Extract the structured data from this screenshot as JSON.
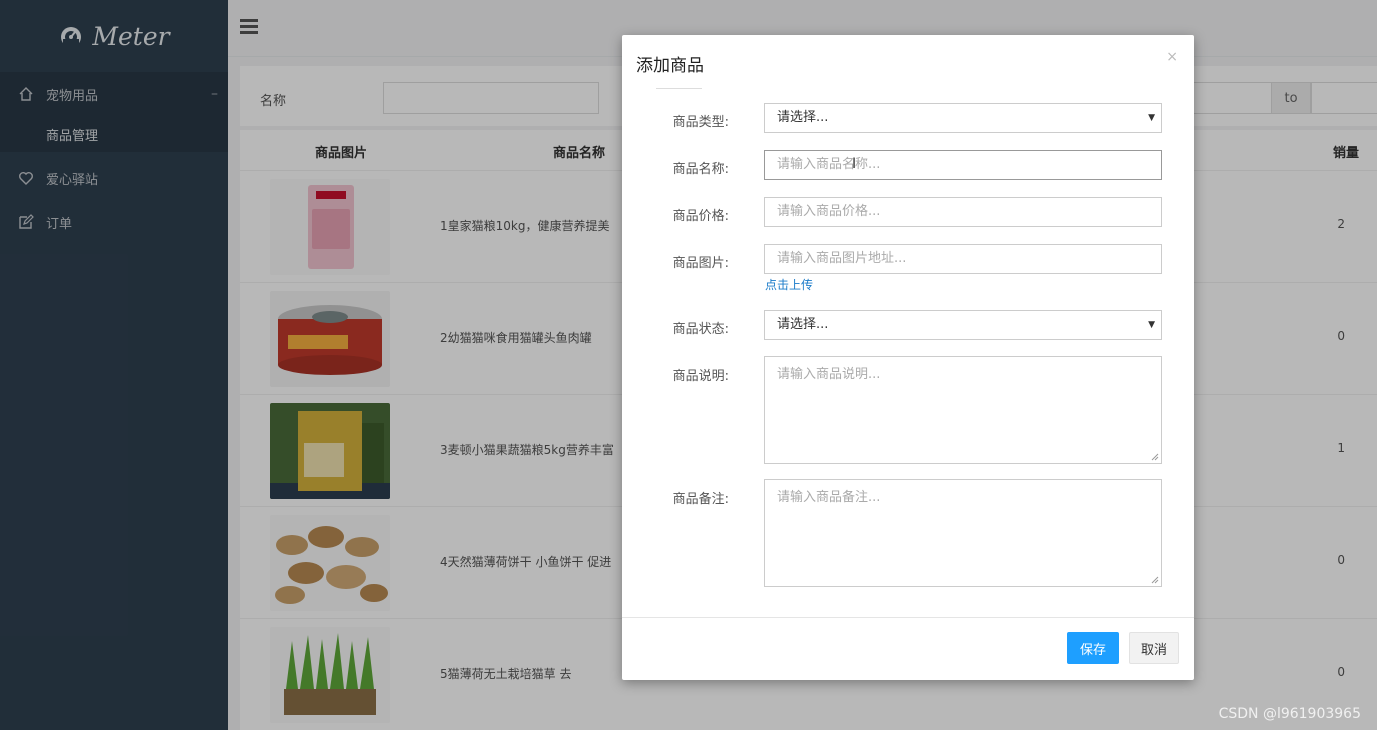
{
  "sidebar": {
    "brand": "Meter",
    "items": [
      {
        "label": "宠物用品"
      },
      {
        "label": "商品管理"
      },
      {
        "label": "爱心驿站"
      },
      {
        "label": "订单"
      }
    ]
  },
  "filter": {
    "name_label": "名称",
    "range_to": "to"
  },
  "table": {
    "headers": [
      "商品图片",
      "商品名称",
      "销量"
    ],
    "rows": [
      {
        "name": "1皇家猫粮10kg，健康营养提美",
        "sales": "2"
      },
      {
        "name": "2幼猫猫咪食用猫罐头鱼肉罐",
        "sales": "0"
      },
      {
        "name": "3麦顿小猫果蔬猫粮5kg营养丰富",
        "sales": "1"
      },
      {
        "name": "4天然猫薄荷饼干 小鱼饼干 促进",
        "sales": "0"
      },
      {
        "name": "5猫薄荷无土栽培猫草 去",
        "sales": "0"
      }
    ]
  },
  "modal": {
    "title": "添加商品",
    "close": "×",
    "fields": {
      "type": {
        "label": "商品类型:",
        "value": "请选择..."
      },
      "name": {
        "label": "商品名称:",
        "placeholder": "请输入商品名称..."
      },
      "price": {
        "label": "商品价格:",
        "placeholder": "请输入商品价格..."
      },
      "image": {
        "label": "商品图片:",
        "placeholder": "请输入商品图片地址..."
      },
      "upload": "点击上传",
      "status": {
        "label": "商品状态:",
        "value": "请选择..."
      },
      "desc": {
        "label": "商品说明:",
        "placeholder": "请输入商品说明..."
      },
      "remark": {
        "label": "商品备注:",
        "placeholder": "请输入商品备注..."
      }
    },
    "save": "保存",
    "cancel": "取消"
  },
  "watermark": "CSDN @l961903965",
  "colors": {
    "sidebar_bg": "#2f4050",
    "primary_button": "#1e9fff",
    "link": "#1a7bc9"
  }
}
